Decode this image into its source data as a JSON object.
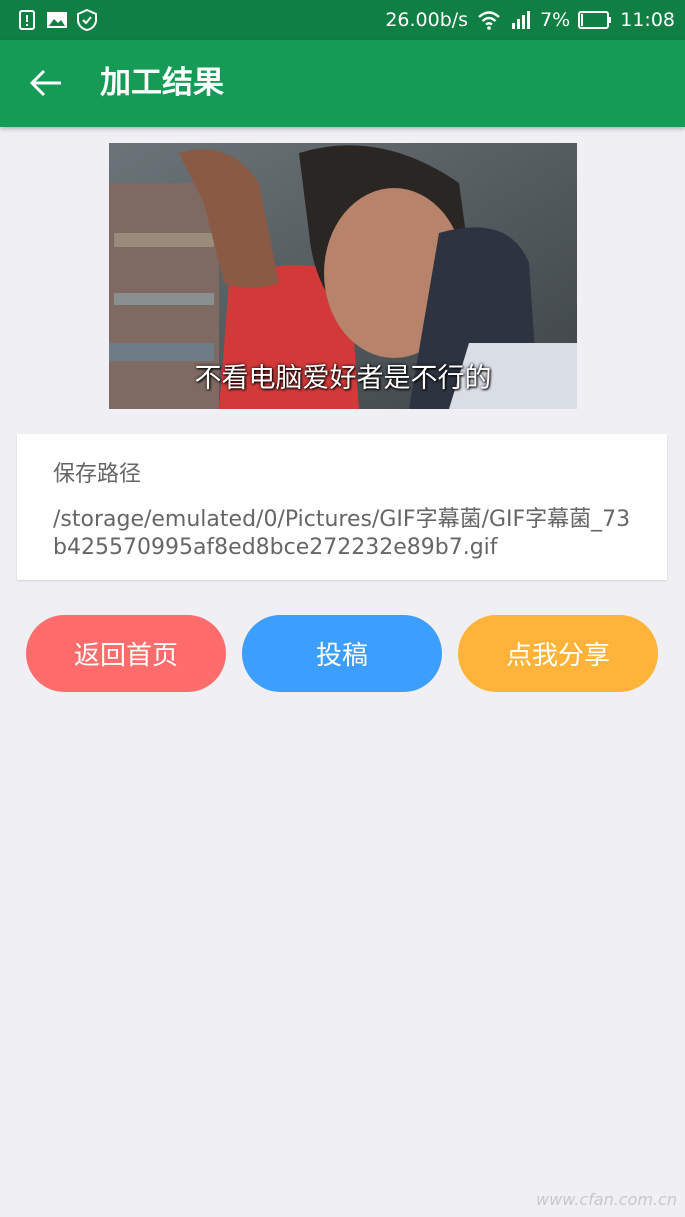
{
  "status_bar": {
    "net_speed": "26.00b/s",
    "battery_percent": "7%",
    "time": "11:08"
  },
  "app_bar": {
    "title": "加工结果"
  },
  "preview": {
    "caption": "不看电脑爱好者是不行的"
  },
  "save_info": {
    "label": "保存路径",
    "path": "/storage/emulated/0/Pictures/GIF字幕菌/GIF字幕菌_73b425570995af8ed8bce272232e89b7.gif"
  },
  "actions": {
    "home": "返回首页",
    "submit": "投稿",
    "share": "点我分享"
  },
  "colors": {
    "status_bar": "#0f7f43",
    "app_bar": "#169b56",
    "home_button": "#ff6c6c",
    "submit_button": "#3c9eff",
    "share_button": "#ffb338"
  },
  "watermark": "www.cfan.com.cn"
}
